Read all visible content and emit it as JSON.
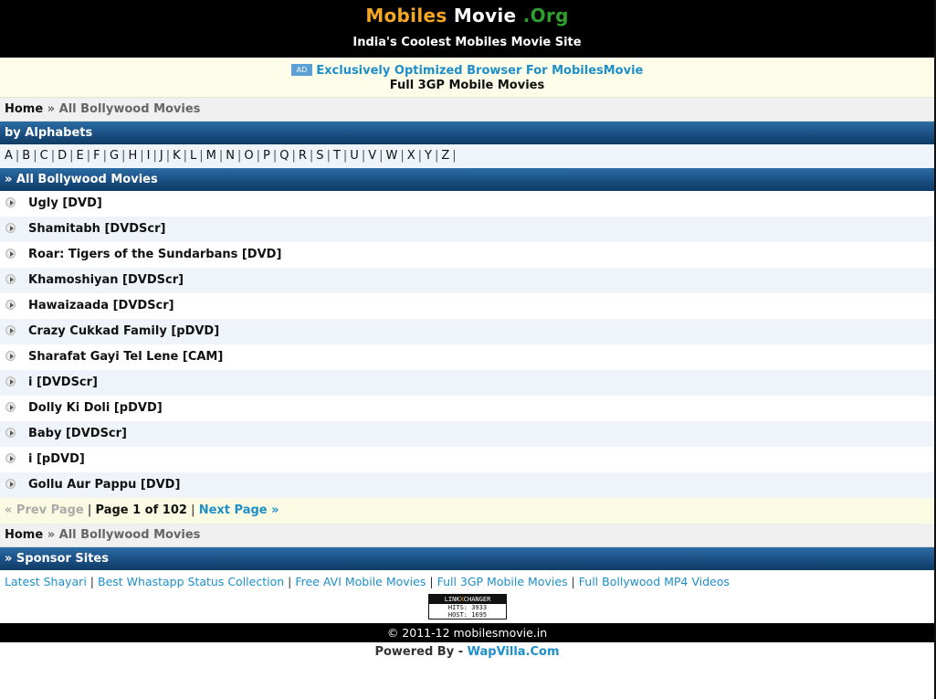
{
  "header": {
    "logo_part1": "Mobiles",
    "logo_part2": " Movie ",
    "logo_part3": ".Org",
    "tagline": "India's Coolest Mobiles Movie Site"
  },
  "ad": {
    "badge": "AD",
    "link_text": "Exclusively Optimized Browser For MobilesMovie",
    "subtitle": "Full 3GP Mobile Movies"
  },
  "breadcrumb": {
    "home": "Home",
    "separator_and_current": " » All Bollywood Movies"
  },
  "sections": {
    "alphabets_title": "by Alphabets",
    "movies_title": "» All Bollywood Movies",
    "sponsors_title": "» Sponsor Sites"
  },
  "alphabet": [
    "A",
    "B",
    "C",
    "D",
    "E",
    "F",
    "G",
    "H",
    "I",
    "J",
    "K",
    "L",
    "M",
    "N",
    "O",
    "P",
    "Q",
    "R",
    "S",
    "T",
    "U",
    "V",
    "W",
    "X",
    "Y",
    "Z"
  ],
  "movies": [
    "Ugly [DVD]",
    "Shamitabh [DVDScr]",
    "Roar: Tigers of the Sundarbans [DVD]",
    "Khamoshiyan [DVDScr]",
    "Hawaizaada [DVDScr]",
    "Crazy Cukkad Family [pDVD]",
    "Sharafat Gayi Tel Lene [CAM]",
    "i [DVDScr]",
    "Dolly Ki Doli [pDVD]",
    "Baby [DVDScr]",
    "i [pDVD]",
    "Gollu Aur Pappu [DVD]"
  ],
  "pager": {
    "prev": "« Prev Page",
    "page_info": "Page 1 of 102",
    "next": "Next Page »"
  },
  "sponsors": [
    "Latest Shayari",
    "Best Whastapp Status Collection",
    "Free AVI Mobile Movies",
    "Full 3GP Mobile Movies",
    "Full Bollywood MP4 Videos"
  ],
  "counter": {
    "brand_left": "LINK",
    "brand_x": "X",
    "brand_right": "CHANGER",
    "hits": "HITS: 3933",
    "host": "HOST: 1695"
  },
  "footer": {
    "copyright": "© 2011-12 mobilesmovie.in",
    "powered_by": "Powered By - ",
    "powered_link": "WapVilla.Com"
  },
  "colors": {
    "logo_orange": "#f5a623",
    "logo_green": "#2e9e2e",
    "link_blue": "#1e8fc9",
    "section_bar": "#1d5489"
  }
}
